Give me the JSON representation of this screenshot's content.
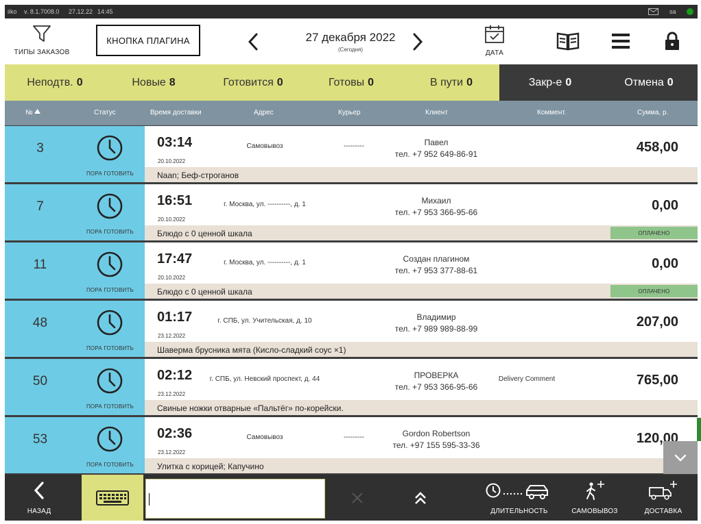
{
  "titlebar": {
    "app": "iiko",
    "version": "v. 8.1.7008.0",
    "date": "27.12.22",
    "time": "14:45",
    "user": "sa",
    "status_color": "#1a9a1a"
  },
  "header": {
    "order_types_label": "ТИПЫ ЗАКАЗОВ",
    "plugin_button_label": "КНОПКА ПЛАГИНА",
    "date_main": "27 декабря 2022",
    "date_sub": "(Сегодня)",
    "date_button_label": "ДАТА"
  },
  "tabs": [
    {
      "label": "Неподтв.",
      "count": "0"
    },
    {
      "label": "Новые",
      "count": "8"
    },
    {
      "label": "Готовится",
      "count": "0"
    },
    {
      "label": "Готовы",
      "count": "0"
    },
    {
      "label": "В пути",
      "count": "0"
    },
    {
      "label": "Закр-е",
      "count": "0"
    },
    {
      "label": "Отмена",
      "count": "0"
    }
  ],
  "columns": {
    "number": "№",
    "status": "Статус",
    "delivery_time": "Время доставки",
    "address": "Адрес",
    "courier": "Курьер",
    "client": "Клиент",
    "comment": "Коммент.",
    "sum": "Сумма, р."
  },
  "orders": [
    {
      "number": "3",
      "status": "ПОРА ГОТОВИТЬ",
      "time": "03:14",
      "date": "20.10.2022",
      "address": "Самовывоз",
      "courier": "---------",
      "client_name": "Павел",
      "client_phone": "тел. +7 952 649-86-91",
      "comment": "",
      "sum": "458,00",
      "items": "Naan; Беф-строганов",
      "paid": ""
    },
    {
      "number": "7",
      "status": "ПОРА ГОТОВИТЬ",
      "time": "16:51",
      "date": "20.10.2022",
      "address": "г. Москва, ул. ----------, д. 1",
      "courier": "",
      "client_name": "Михаил",
      "client_phone": "тел. +7 953 366-95-66",
      "comment": "",
      "sum": "0,00",
      "items": "Блюдо с 0 ценной шкала",
      "paid": "ОПЛАЧЕНО"
    },
    {
      "number": "11",
      "status": "ПОРА ГОТОВИТЬ",
      "time": "17:47",
      "date": "20.10.2022",
      "address": "г. Москва, ул. ----------, д. 1",
      "courier": "",
      "client_name": "Создан плагином",
      "client_phone": "тел. +7 953 377-88-61",
      "comment": "",
      "sum": "0,00",
      "items": "Блюдо с 0 ценной шкала",
      "paid": "ОПЛАЧЕНО"
    },
    {
      "number": "48",
      "status": "ПОРА ГОТОВИТЬ",
      "time": "01:17",
      "date": "23.12.2022",
      "address": "г. СПБ, ул. Учительская, д. 10",
      "courier": "",
      "client_name": "Владимир",
      "client_phone": "тел. +7 989 989-88-99",
      "comment": "",
      "sum": "207,00",
      "items": "Шаверма брусника мята (Кисло-сладкий соус ×1)",
      "paid": ""
    },
    {
      "number": "50",
      "status": "ПОРА ГОТОВИТЬ",
      "time": "02:12",
      "date": "23.12.2022",
      "address": "г. СПБ, ул. Невский проспект, д. 44",
      "courier": "",
      "client_name": "ПРОВЕРКА",
      "client_phone": "тел. +7 953 366-95-66",
      "comment": "Delivery Comment",
      "sum": "765,00",
      "items": "Свиные ножки отварные «Пальтёг» по-корейски.",
      "paid": ""
    },
    {
      "number": "53",
      "status": "ПОРА ГОТОВИТЬ",
      "time": "02:36",
      "date": "23.12.2022",
      "address": "Самовывоз",
      "courier": "---------",
      "client_name": "Gordon Robertson",
      "client_phone": "тел. +97 155 595-33-36",
      "comment": "",
      "sum": "120,00",
      "items": "Улитка с корицей; Капучино",
      "paid": ""
    }
  ],
  "bottom": {
    "back_label": "НАЗАД",
    "duration_label": "ДЛИТЕЛЬНОСТЬ",
    "pickup_label": "САМОВЫВОЗ",
    "delivery_label": "ДОСТАВКА",
    "search_value": ""
  },
  "icons": {
    "order_types": "filter-icon",
    "date": "calendar-icon",
    "book": "book-icon",
    "menu": "menu-icon",
    "lock": "lock-icon",
    "sort": "sort-asc-icon",
    "clock": "clock-icon",
    "scroll": "chevron-down-icon",
    "back": "chevron-left-icon",
    "keyboard": "keyboard-icon",
    "clear": "close-icon",
    "scroll_top": "double-chevron-up-icon",
    "duration": "clock-car-icon",
    "pickup": "walker-plus-icon",
    "delivery": "truck-plus-icon"
  },
  "colors": {
    "tab_yellow": "#dde07e",
    "tab_dark": "#3a3a3a",
    "column_header": "#7f93a0",
    "row_blue": "#6ecbe5",
    "items_beige": "#e9e0d6",
    "paid_green": "#8fc48b",
    "bottom_bar": "#303030"
  }
}
